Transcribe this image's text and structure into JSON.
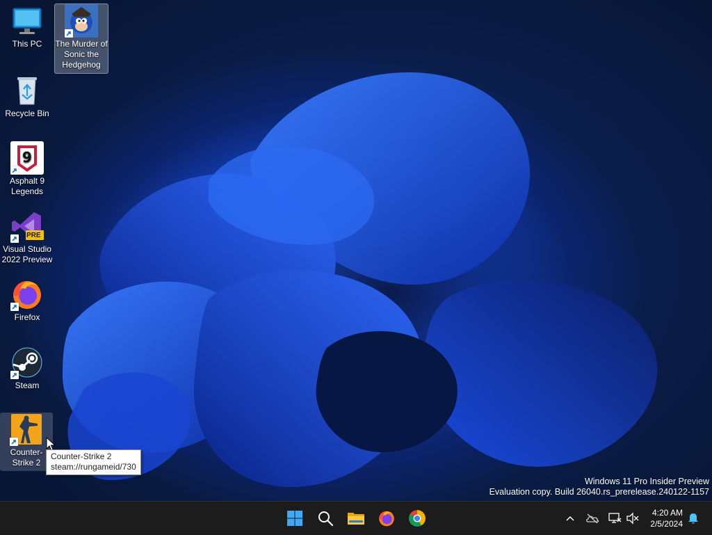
{
  "desktop_icons": [
    {
      "label": "This PC",
      "icon": "monitor-icon",
      "shortcut": false
    },
    {
      "label": "The Murder of Sonic the Hedgehog",
      "icon": "sonic-game-icon",
      "shortcut": true
    },
    {
      "label": "Recycle Bin",
      "icon": "recycle-bin-icon",
      "shortcut": false
    },
    {
      "label": "Asphalt 9 Legends",
      "icon": "asphalt-9-icon",
      "shortcut": true
    },
    {
      "label": "Visual Studio 2022 Preview",
      "icon": "visual-studio-preview-icon",
      "badge": "PRE",
      "shortcut": true
    },
    {
      "label": "Firefox",
      "icon": "firefox-icon",
      "shortcut": true
    },
    {
      "label": "Steam",
      "icon": "steam-icon",
      "shortcut": true
    },
    {
      "label": "Counter-Strike 2",
      "icon": "counter-strike-icon",
      "shortcut": true
    }
  ],
  "tooltip": {
    "title": "Counter-Strike 2",
    "url": "steam://rungameid/730"
  },
  "watermark": {
    "line1": "Windows 11 Pro Insider Preview",
    "line2": "Evaluation copy. Build 26040.rs_prerelease.240122-1157"
  },
  "taskbar": {
    "pinned": [
      {
        "icon": "windows-start-icon"
      },
      {
        "icon": "search-icon"
      },
      {
        "icon": "file-explorer-icon"
      },
      {
        "icon": "firefox-icon"
      },
      {
        "icon": "chrome-icon"
      }
    ],
    "tray": [
      {
        "icon": "chevron-up-icon"
      },
      {
        "icon": "onedrive-offline-icon"
      },
      {
        "icon": "network-icon"
      },
      {
        "icon": "speaker-muted-icon"
      }
    ],
    "clock": {
      "time": "4:20 AM",
      "date": "2/5/2024"
    },
    "notification_icon": "bell-icon"
  },
  "colors": {
    "taskbar_bg": "#1c1c1c",
    "wallpaper_blue": "#1f5cf0",
    "wallpaper_dark": "#07142e",
    "start_blue": "#3fa9f5"
  }
}
